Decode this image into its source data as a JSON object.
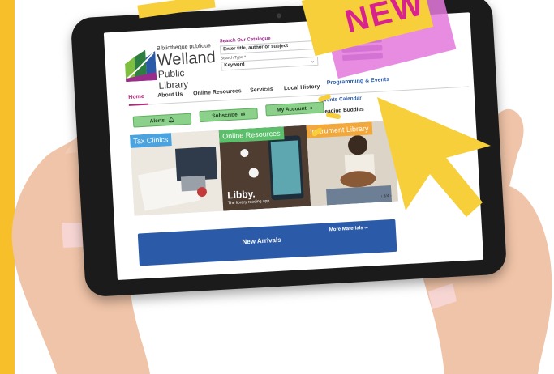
{
  "logo": {
    "french": "Bibliothèque publique",
    "name": "Welland",
    "subtitle": "Public Library"
  },
  "search": {
    "title": "Search Our Catalogue",
    "placeholder": "Enter title, author or subject",
    "type_label": "Search Type *",
    "type_value": "Keyword"
  },
  "nav": {
    "items": [
      "Home",
      "About Us",
      "Online Resources",
      "Services",
      "Local History",
      "Programming & Events"
    ]
  },
  "dropdown": {
    "items": [
      "Events Calendar",
      "Reading Buddies"
    ]
  },
  "quick_buttons": {
    "alerts": "Alerts",
    "subscribe": "Subscribe",
    "account": "My Account"
  },
  "carousel": {
    "slides": [
      {
        "label": "Tax Clinics"
      },
      {
        "label": "Online Resources",
        "title": "Libby.",
        "subtitle": "The library reading app"
      },
      {
        "label": "Instrument Library"
      }
    ],
    "pager": "‹  3/4  ›"
  },
  "arrivals": {
    "title": "New Arrivals",
    "more": "More Materials"
  },
  "overlay": {
    "badge_text": "NEW"
  },
  "colors": {
    "accent_yellow": "#f7c02b",
    "pink": "#e478dc",
    "brand_blue": "#2a5aa8",
    "button_green": "#8bd18b",
    "nav_active": "#b0287a"
  }
}
